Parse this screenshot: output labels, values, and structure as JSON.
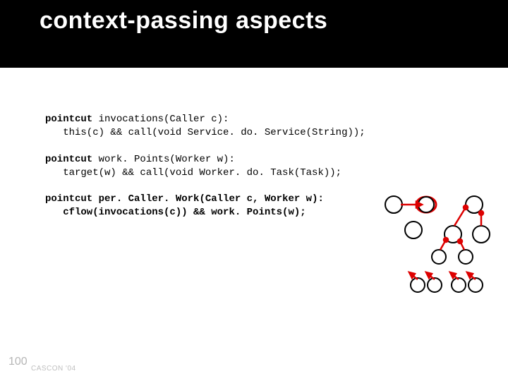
{
  "title": "context-passing aspects",
  "code": {
    "kw": "pointcut",
    "p1_sig": " invocations(Caller c):",
    "p1_body": "   this(c) && call(void Service. do. Service(String));",
    "p2_sig": " work. Points(Worker w):",
    "p2_body": "   target(w) && call(void Worker. do. Task(Task));",
    "p3_sig": " per. Caller. Work(Caller c, Worker w):",
    "p3_body": "   cflow(invocations(c)) && work. Points(w);"
  },
  "page_number": "100",
  "footer": "CASCON '04"
}
